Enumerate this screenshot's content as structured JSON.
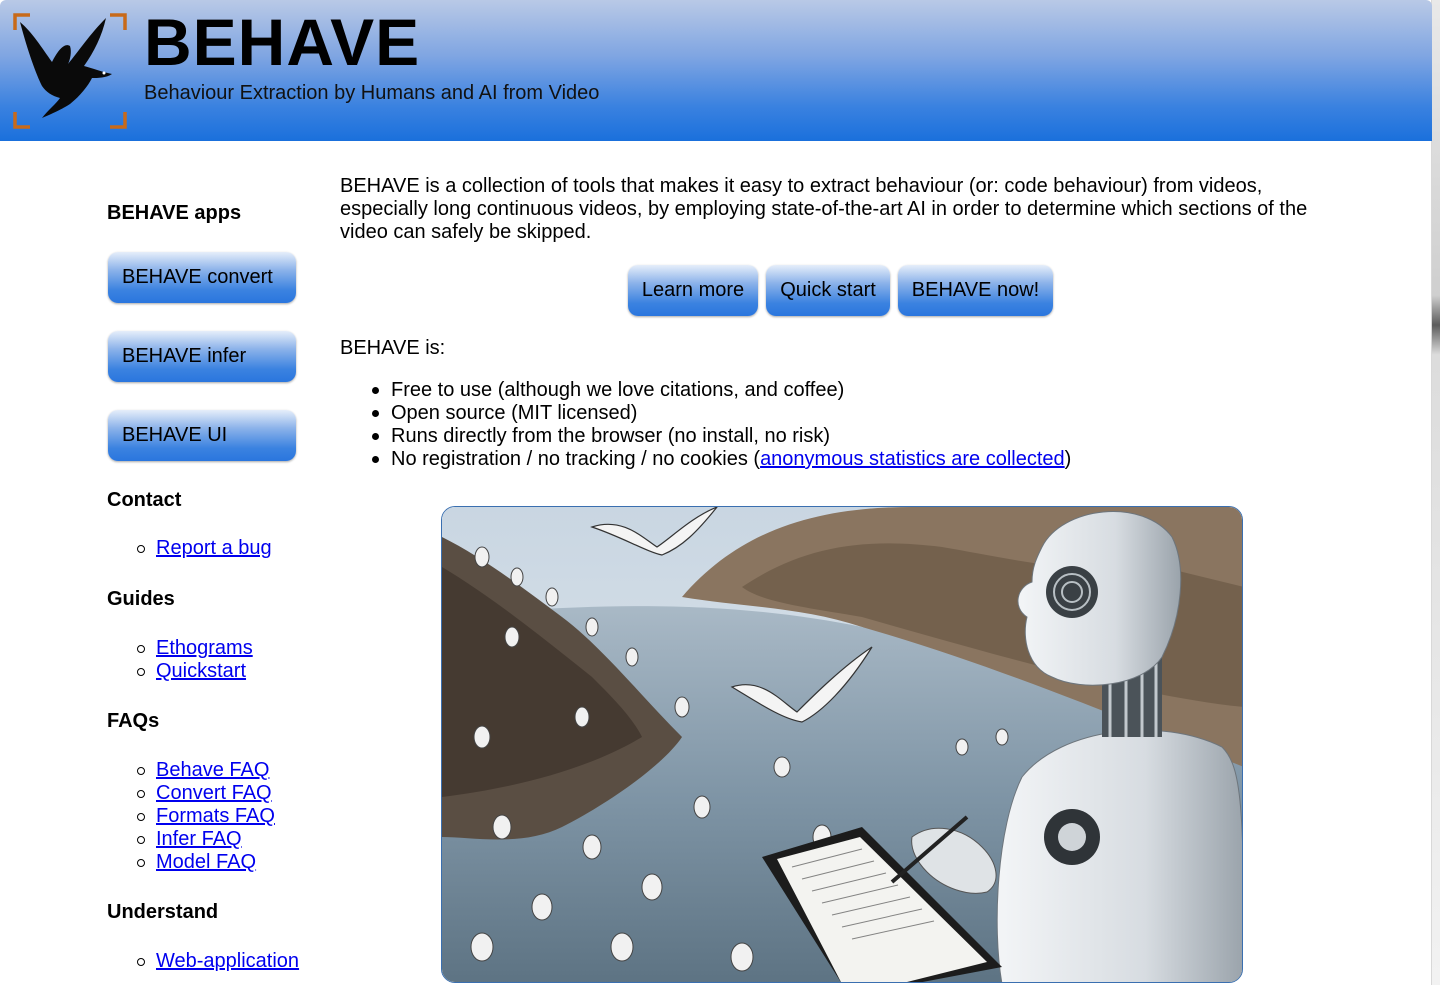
{
  "header": {
    "title": "BEHAVE",
    "subtitle": "Behaviour Extraction by Humans and AI from Video",
    "logo_icon": "bird-in-frame-icon"
  },
  "sidebar": {
    "apps_heading": "BEHAVE apps",
    "apps": [
      {
        "label": "BEHAVE convert"
      },
      {
        "label": "BEHAVE infer"
      },
      {
        "label": "BEHAVE UI"
      }
    ],
    "sections": [
      {
        "heading": "Contact",
        "links": [
          "Report a bug"
        ]
      },
      {
        "heading": "Guides",
        "links": [
          "Ethograms",
          "Quickstart"
        ]
      },
      {
        "heading": "FAQs",
        "links": [
          "Behave FAQ",
          "Convert FAQ",
          "Formats FAQ",
          "Infer FAQ",
          "Model FAQ"
        ]
      },
      {
        "heading": "Understand",
        "links": [
          "Web-application"
        ]
      }
    ]
  },
  "main": {
    "intro": "BEHAVE is a collection of tools that makes it easy to extract behaviour (or: code behaviour) from videos, especially long continuous videos, by employing state-of-the-art AI in order to determine which sections of the video can safely be skipped.",
    "buttons": [
      "Learn more",
      "Quick start",
      "BEHAVE now!"
    ],
    "is_heading": "BEHAVE is:",
    "features": [
      {
        "text": "Free to use (although we love citations, and coffee)"
      },
      {
        "text": "Open source (MIT licensed)"
      },
      {
        "text": "Runs directly from the browser (no install, no risk)"
      },
      {
        "text": "No registration / no tracking / no cookies (",
        "link": "anonymous statistics are collected",
        "suffix": ")"
      }
    ],
    "hero_image": "robot-observing-seabirds-illustration"
  },
  "colors": {
    "header_gradient_top": "#b9c9e6",
    "header_gradient_bottom": "#1a70dc",
    "button_blue": "#3b82e0",
    "link": "#0000ee"
  }
}
